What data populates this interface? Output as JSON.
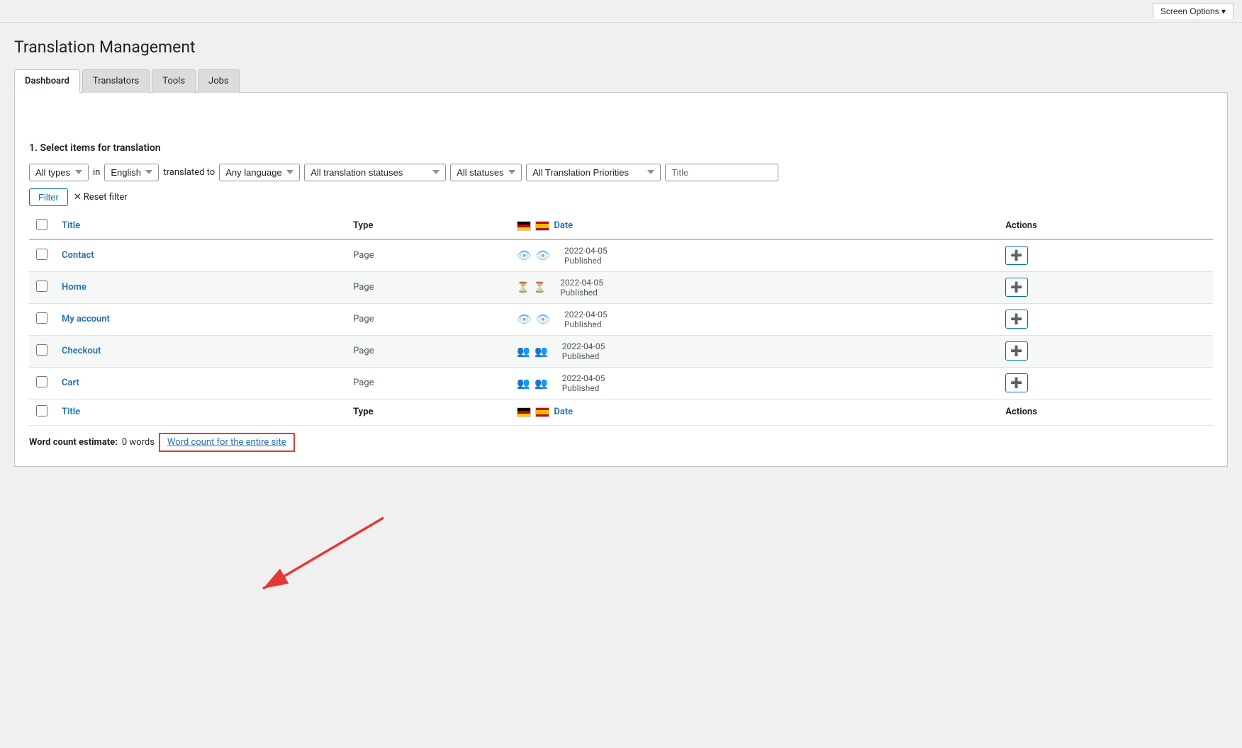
{
  "header": {
    "screen_options": "Screen Options ▾"
  },
  "page": {
    "title": "Translation Management"
  },
  "tabs": [
    {
      "id": "dashboard",
      "label": "Dashboard",
      "active": true
    },
    {
      "id": "translators",
      "label": "Translators",
      "active": false
    },
    {
      "id": "tools",
      "label": "Tools",
      "active": false
    },
    {
      "id": "jobs",
      "label": "Jobs",
      "active": false
    }
  ],
  "section": {
    "title": "1. Select items for translation"
  },
  "filters": {
    "types_label": "All types",
    "in_label": "in",
    "language_label": "English",
    "translated_to_label": "translated to",
    "any_language_label": "Any language",
    "statuses_label": "All translation statuses",
    "all_statuses_label": "All statuses",
    "priorities_label": "All Translation Priorities",
    "title_placeholder": "Title",
    "filter_btn": "Filter",
    "reset_filter": "Reset filter"
  },
  "table": {
    "headers": {
      "title": "Title",
      "type": "Type",
      "date": "Date",
      "actions": "Actions"
    },
    "rows": [
      {
        "id": 1,
        "title": "Contact",
        "type": "Page",
        "flag1_status": "eye",
        "flag2_status": "eye",
        "date": "2022-04-05",
        "status": "Published"
      },
      {
        "id": 2,
        "title": "Home",
        "type": "Page",
        "flag1_status": "hourglass",
        "flag2_status": "hourglass",
        "date": "2022-04-05",
        "status": "Published"
      },
      {
        "id": 3,
        "title": "My account",
        "type": "Page",
        "flag1_status": "eye",
        "flag2_status": "eye",
        "date": "2022-04-05",
        "status": "Published"
      },
      {
        "id": 4,
        "title": "Checkout",
        "type": "Page",
        "flag1_status": "people",
        "flag2_status": "people",
        "date": "2022-04-05",
        "status": "Published"
      },
      {
        "id": 5,
        "title": "Cart",
        "type": "Page",
        "flag1_status": "people",
        "flag2_status": "people",
        "date": "2022-04-05",
        "status": "Published"
      }
    ]
  },
  "footer": {
    "word_count_label": "Word count estimate:",
    "word_count_value": "0 words",
    "word_count_link": "Word count for the entire site"
  }
}
